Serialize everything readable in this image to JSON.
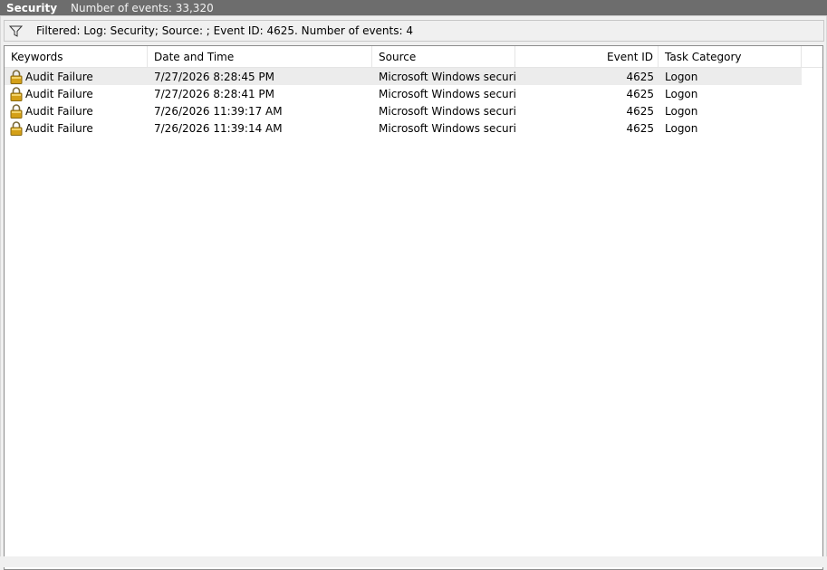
{
  "title_bar": {
    "log_name": "Security",
    "event_count": "Number of events: 33,320"
  },
  "filter_bar": {
    "icon": "funnel-icon",
    "text": "Filtered: Log: Security; Source: ; Event ID: 4625. Number of events: 4"
  },
  "table": {
    "columns": [
      "Keywords",
      "Date and Time",
      "Source",
      "Event ID",
      "Task Category"
    ],
    "rows": [
      {
        "keywords": "Audit Failure",
        "date": "7/27/2026 8:28:45 PM",
        "source": "Microsoft Windows securi...",
        "event_id": "4625",
        "category": "Logon",
        "icon": "lock-icon"
      },
      {
        "keywords": "Audit Failure",
        "date": "7/27/2026 8:28:41 PM",
        "source": "Microsoft Windows securi...",
        "event_id": "4625",
        "category": "Logon",
        "icon": "lock-icon"
      },
      {
        "keywords": "Audit Failure",
        "date": "7/26/2026 11:39:17 AM",
        "source": "Microsoft Windows securi...",
        "event_id": "4625",
        "category": "Logon",
        "icon": "lock-icon"
      },
      {
        "keywords": "Audit Failure",
        "date": "7/26/2026 11:39:14 AM",
        "source": "Microsoft Windows securi...",
        "event_id": "4625",
        "category": "Logon",
        "icon": "lock-icon"
      }
    ]
  },
  "colors": {
    "title_bar_bg": "#6d6d6d",
    "selected_row_bg": "#ececec",
    "lock_gold": "#d4a017"
  }
}
